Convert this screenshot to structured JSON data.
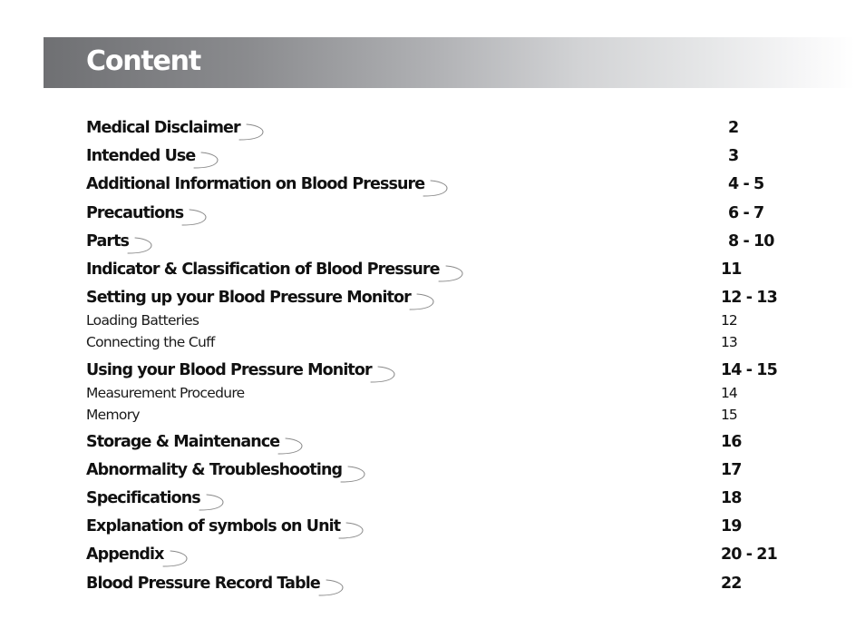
{
  "header": {
    "title": "Content"
  },
  "toc": {
    "entries": [
      {
        "label": "Medical Disclaimer",
        "page": "2",
        "level": "main"
      },
      {
        "label": "Intended Use",
        "page": "3",
        "level": "main"
      },
      {
        "label": "Additional Information on Blood Pressure",
        "page": "4 - 5",
        "level": "main"
      },
      {
        "label": "Precautions",
        "page": "6 - 7",
        "level": "main"
      },
      {
        "label": "Parts",
        "page": "8 - 10",
        "level": "main"
      },
      {
        "label": "Indicator & Classification of Blood Pressure",
        "page": "11",
        "level": "main"
      },
      {
        "label": "Setting up your Blood Pressure Monitor",
        "page": "12 - 13",
        "level": "main"
      },
      {
        "label": "Loading Batteries",
        "page": "12",
        "level": "sub"
      },
      {
        "label": "Connecting the Cuff",
        "page": "13",
        "level": "sub"
      },
      {
        "label": "Using your Blood Pressure Monitor",
        "page": "14 - 15",
        "level": "main"
      },
      {
        "label": "Measurement Procedure",
        "page": "14",
        "level": "sub"
      },
      {
        "label": "Memory",
        "page": "15",
        "level": "sub"
      },
      {
        "label": "Storage & Maintenance",
        "page": "16",
        "level": "main"
      },
      {
        "label": "Abnormality & Troubleshooting",
        "page": "17",
        "level": "main"
      },
      {
        "label": "Specifications",
        "page": "18",
        "level": "main"
      },
      {
        "label": "Explanation of symbols on Unit",
        "page": "19",
        "level": "main"
      },
      {
        "label": "Appendix",
        "page": "20 - 21",
        "level": "main"
      },
      {
        "label": "Blood Pressure Record Table",
        "page": "22",
        "level": "main"
      }
    ]
  },
  "colors": {
    "banner_start": "#6f7073",
    "banner_end": "#ffffff",
    "title_text": "#ffffff",
    "body_text": "#111111",
    "swoosh": "#8a8a8a"
  }
}
